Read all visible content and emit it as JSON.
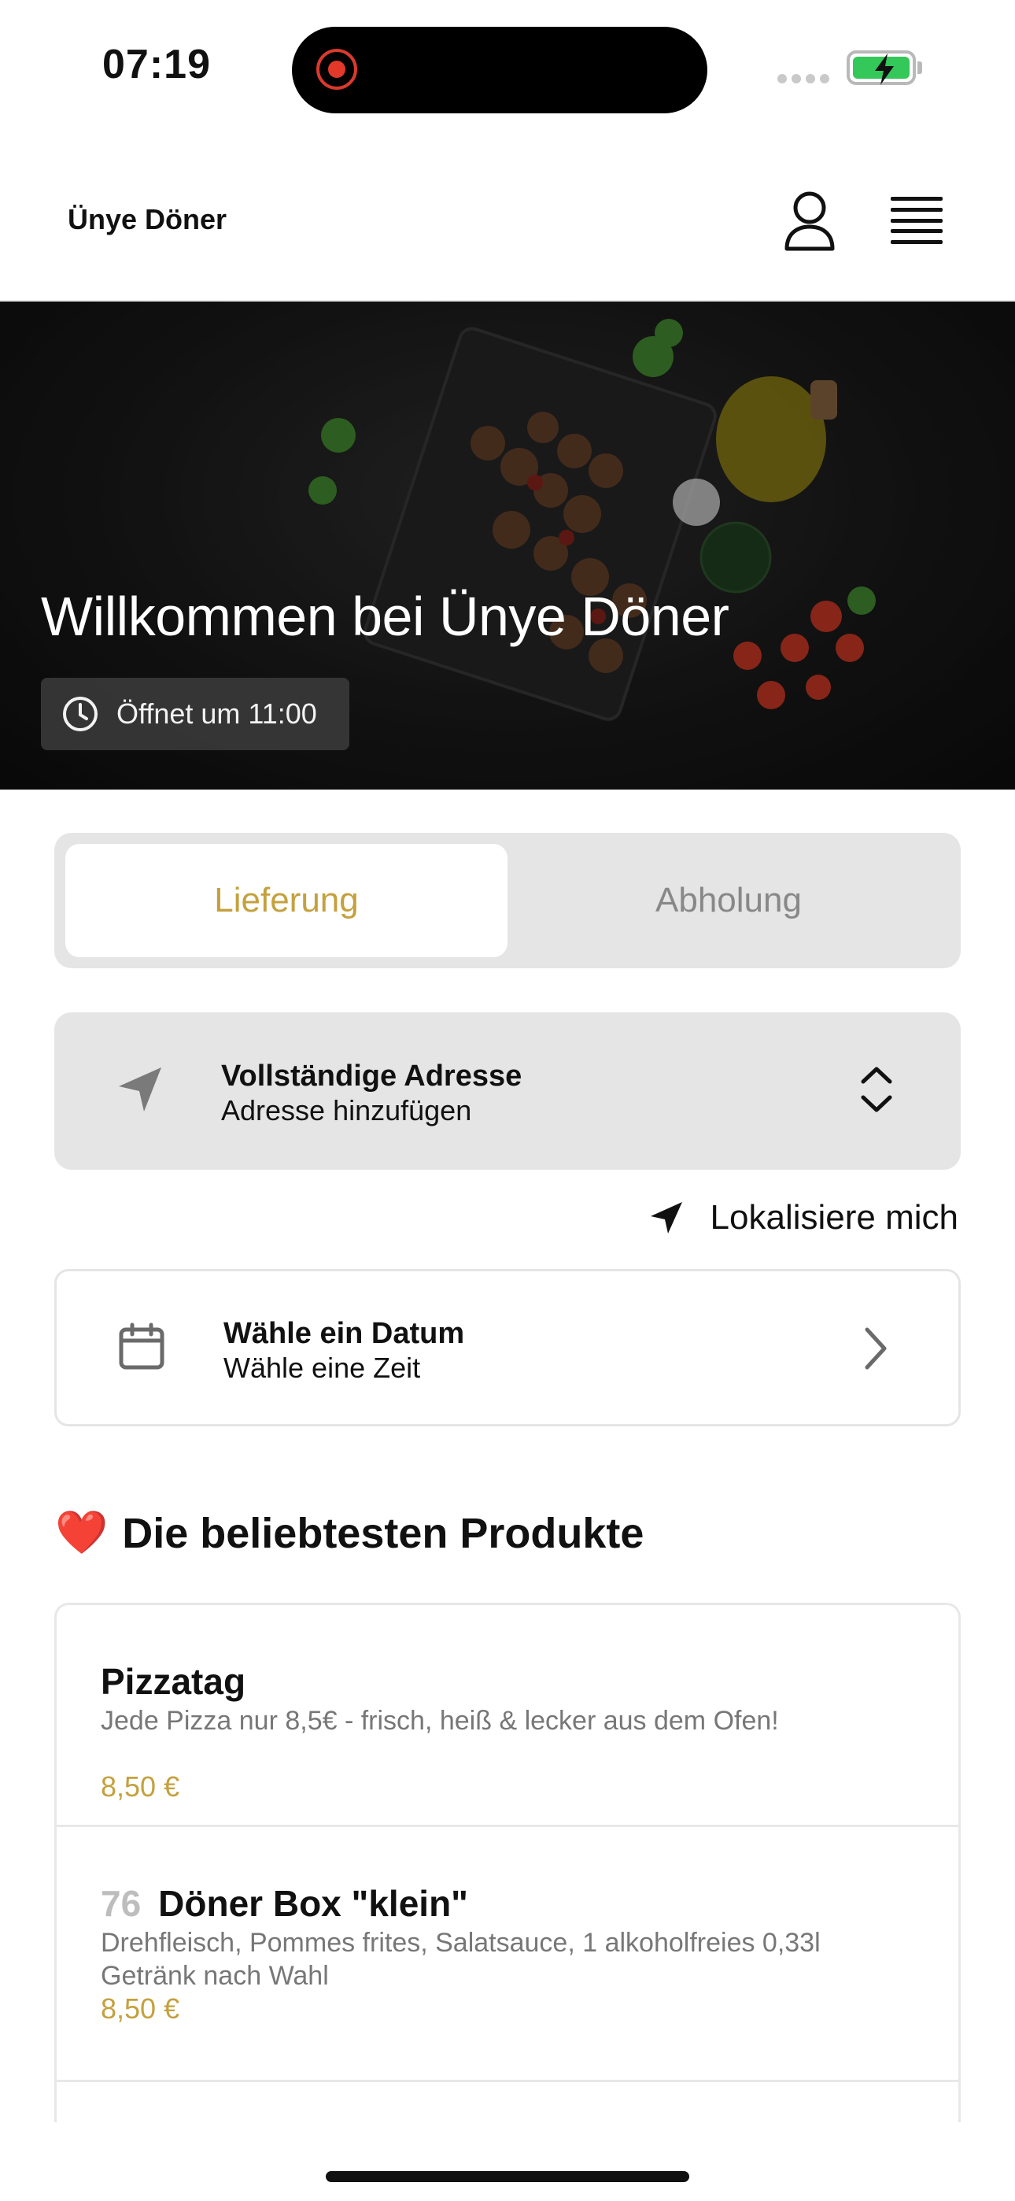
{
  "status_bar": {
    "time": "07:19"
  },
  "header": {
    "brand": "Ünye Döner"
  },
  "hero": {
    "title": "Willkommen bei Ünye Döner",
    "opening_badge": "Öffnet um 11:00"
  },
  "order_mode": {
    "options": [
      "Lieferung",
      "Abholung"
    ],
    "selected": "Lieferung"
  },
  "address": {
    "title": "Vollständige Adresse",
    "subtitle": "Adresse hinzufügen"
  },
  "locate_me": {
    "label": "Lokalisiere mich"
  },
  "schedule": {
    "title": "Wähle ein Datum",
    "subtitle": "Wähle eine Zeit"
  },
  "popular": {
    "heading_emoji": "❤️",
    "heading": "Die beliebtesten Produkte",
    "items": [
      {
        "number": "",
        "name": "Pizzatag",
        "description": "Jede Pizza nur 8,5€ - frisch, heiß & lecker aus dem Ofen!",
        "price": "8,50 €"
      },
      {
        "number": "76",
        "name": "Döner Box \"klein\"",
        "description": "Drehfleisch, Pommes frites, Salatsauce, 1 alkoholfreies 0,33l Getränk nach Wahl",
        "price": "8,50 €"
      }
    ]
  },
  "colors": {
    "accent": "#c4a13e",
    "muted_bg": "#e5e5e5",
    "battery": "#34c759"
  },
  "icons": [
    "user-icon",
    "menu-icon",
    "clock-icon",
    "navigation-arrow-icon",
    "chevron-up-down-icon",
    "calendar-icon",
    "chevron-right-icon",
    "heart-icon"
  ]
}
